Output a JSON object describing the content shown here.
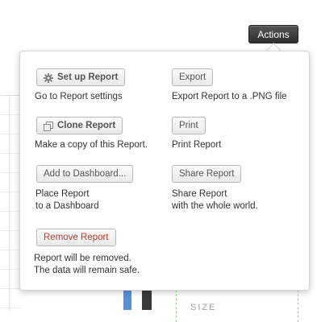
{
  "actions_button": {
    "label": "Actions"
  },
  "menu": {
    "setup": {
      "label": "Set up Report",
      "desc": "Go to Report settings",
      "icon": "gear-icon"
    },
    "export": {
      "label": "Export",
      "desc": "Export Report to a .PNG file"
    },
    "clone": {
      "label": "Clone Report",
      "desc": "Make a copy of this Report.",
      "icon": "copy-icon"
    },
    "print": {
      "label": "Print",
      "desc": "Print Report"
    },
    "dashboard": {
      "label": "Add to Dashboard...",
      "desc_line1": "Place Report",
      "desc_line2": "to a Dashboard"
    },
    "share": {
      "label": "Share Report",
      "desc_line1": "Share Report",
      "desc_line2": "with the whole world."
    },
    "remove": {
      "label": "Remove Report",
      "desc_line1": "Report will be removed.",
      "desc_line2": "The data will remain safe."
    }
  },
  "background": {
    "size_label": "SIZE"
  },
  "colors": {
    "danger": "#c0392b",
    "actions_bg": "#3a3a3a"
  }
}
